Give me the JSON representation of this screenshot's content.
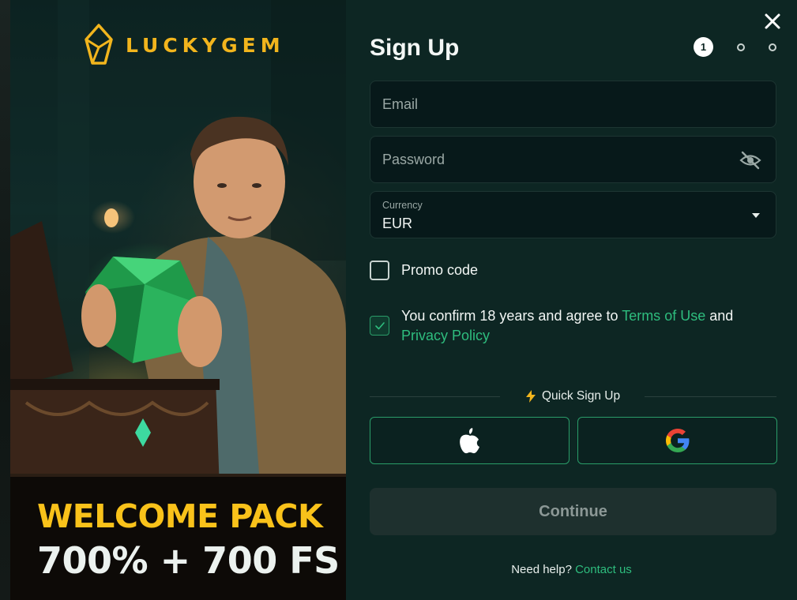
{
  "promo": {
    "logo_text": "LUCKYGEM",
    "headline": "WELCOME PACK",
    "subline": "700% + 700 FS"
  },
  "signup": {
    "title": "Sign Up",
    "steps": {
      "current": "1",
      "total": 3
    },
    "email_placeholder": "Email",
    "password_placeholder": "Password",
    "currency_label": "Currency",
    "currency_value": "EUR",
    "promo_label": "Promo code",
    "promo_checked": false,
    "terms": {
      "checked": true,
      "prefix": "You confirm 18 years and agree to ",
      "terms_link": "Terms of Use",
      "middle": " and ",
      "privacy_link": "Privacy Policy"
    },
    "quick_signup_label": "Quick Sign Up",
    "social": [
      "apple",
      "google"
    ],
    "continue_label": "Continue",
    "help_text": "Need help?",
    "contact_link": "Contact us"
  },
  "colors": {
    "panel_bg": "#0d2623",
    "accent_green": "#2ebd7e",
    "brand_gold": "#f2b51d",
    "headline_yellow": "#f9c21a"
  },
  "icons": [
    "gem-logo-icon",
    "close-icon",
    "eye-slash-icon",
    "caret-down-icon",
    "checkmark-icon",
    "lightning-icon",
    "apple-icon",
    "google-icon"
  ]
}
